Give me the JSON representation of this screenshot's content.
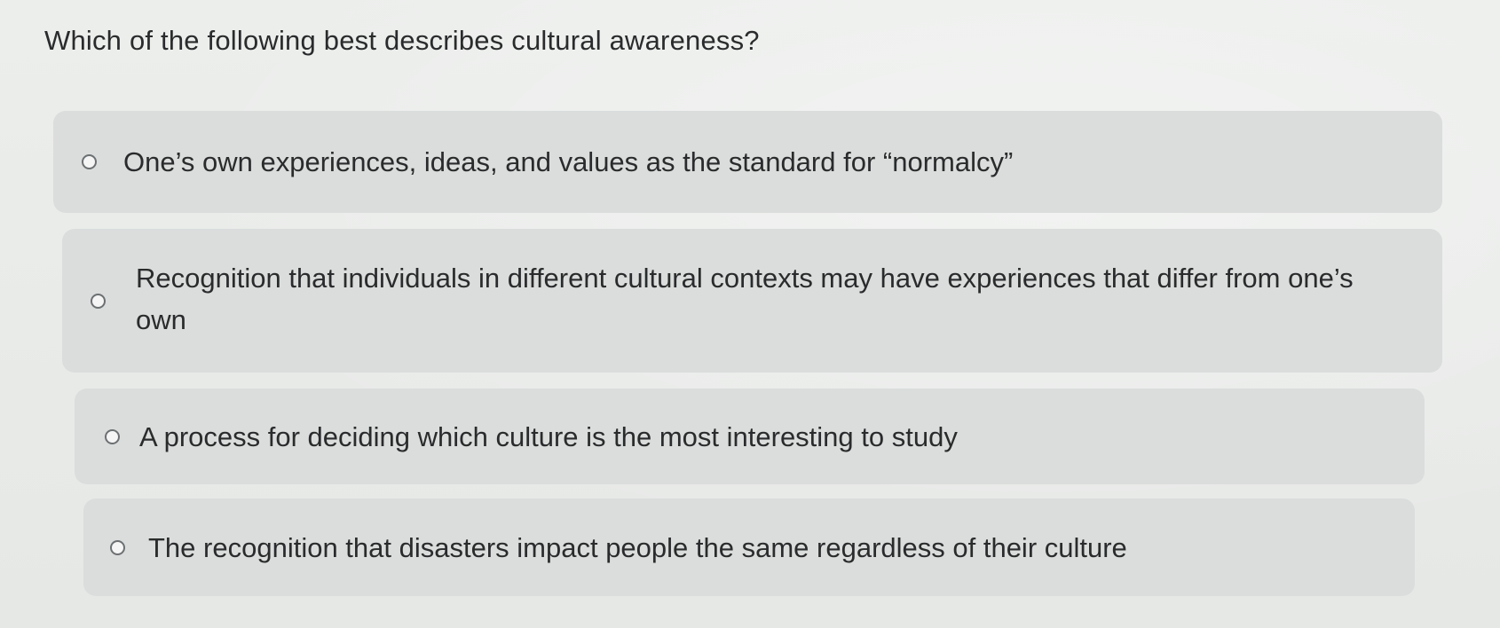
{
  "question": {
    "text": "Which of the following best describes cultural awareness?"
  },
  "options": [
    {
      "label": "One’s own experiences, ideas, and values as the standard for “normalcy”",
      "selected": false
    },
    {
      "label": "Recognition that individuals in different cultural contexts may have experiences that differ from one’s own",
      "selected": false
    },
    {
      "label": "A process for deciding which culture is the most interesting to study",
      "selected": false
    },
    {
      "label": "The recognition that disasters impact people the same regardless of their culture",
      "selected": false
    }
  ]
}
